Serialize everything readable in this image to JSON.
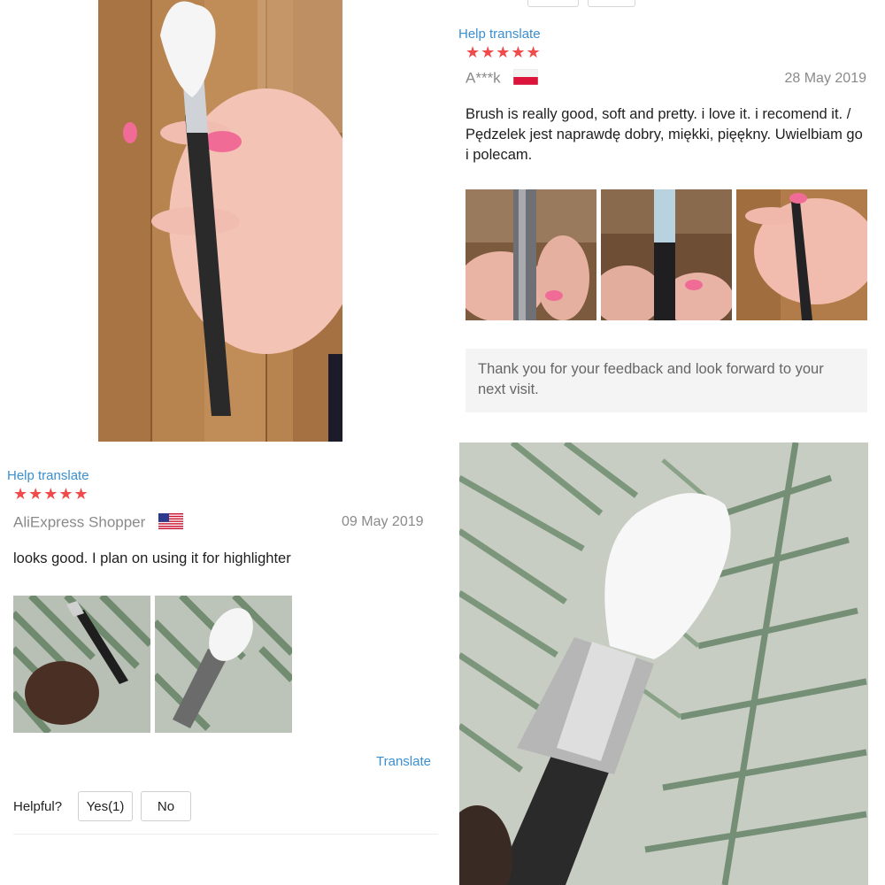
{
  "review_top": {
    "help_translate": "Help translate",
    "stars": "★★★★★",
    "author": "A***k",
    "flag": "poland-flag",
    "date": "28 May 2019",
    "text": "Brush is really good, soft and pretty. i love it. i recomend it. / Pędzelek jest naprawdę dobry, miękki, pięękny. Uwielbiam go i polecam.",
    "photos": [
      "review-photo-1",
      "review-photo-2",
      "review-photo-3"
    ],
    "seller_reply": "Thank you for your feedback and look forward to your next visit."
  },
  "review_bottom": {
    "help_translate": "Help translate",
    "stars": "★★★★★",
    "author": "AliExpress Shopper",
    "flag": "usa-flag",
    "date": "09 May 2019",
    "text": "looks good. I plan on using it for highlighter",
    "photos": [
      "review-photo-1",
      "review-photo-2"
    ],
    "translate": "Translate",
    "helpful_label": "Helpful?",
    "yes_label": "Yes(1)",
    "no_label": "No"
  },
  "colors": {
    "link": "#3a8fd1",
    "stars": "#f04a4a",
    "muted": "#8a8a8a",
    "reply_bg": "#f4f4f4"
  }
}
